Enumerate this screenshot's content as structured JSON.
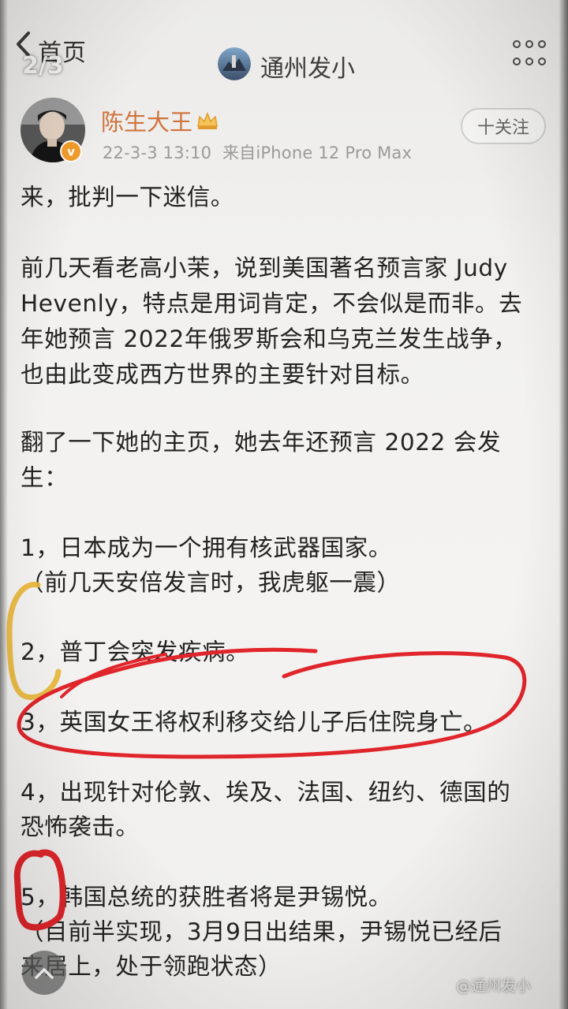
{
  "nav": {
    "back_label": "首页",
    "page_indicator": "2/3",
    "account_name": "通州发小"
  },
  "post": {
    "username": "陈生大王",
    "timestamp": "22-3-3 13:10",
    "source": "来自iPhone 12 Pro Max",
    "follow_label": "十关注",
    "lines": [
      "来，批判一下迷信。",
      "前几天看老高小茉，说到美国著名预言家 Judy",
      "Hevenly，特点是用词肯定，不会似是而非。去",
      "年她预言 2022年俄罗斯会和乌克兰发生战争，",
      "也由此变成西方世界的主要针对目标。",
      "翻了一下她的主页，她去年还预言 2022 会发",
      "生：",
      "1，日本成为一个拥有核武器国家。",
      "（前几天安倍发言时，我虎躯一震）",
      "2，普丁会突发疾病。",
      "3，英国女王将权利移交给儿子后住院身亡。",
      "4，出现针对伦敦、埃及、法国、纽约、德国的",
      "恐怖袭击。",
      "5，韩国总统的获胜者将是尹锡悦。",
      "（目前半实现，3月9日出结果，尹锡悦已经后",
      "来居上，处于领跑状态）"
    ]
  },
  "watermark": {
    "text": "@通州发小"
  },
  "colors": {
    "username": "#d0733d",
    "annotation_red": "#e0252b",
    "annotation_yellow": "#e9b533",
    "body_text": "#232323",
    "meta_text": "#9a9a9a"
  },
  "icons": [
    "back-chevron-icon",
    "more-dots-icon",
    "verify-badge-icon",
    "crown-icon",
    "chevron-up-icon",
    "weibo-logo-icon"
  ]
}
